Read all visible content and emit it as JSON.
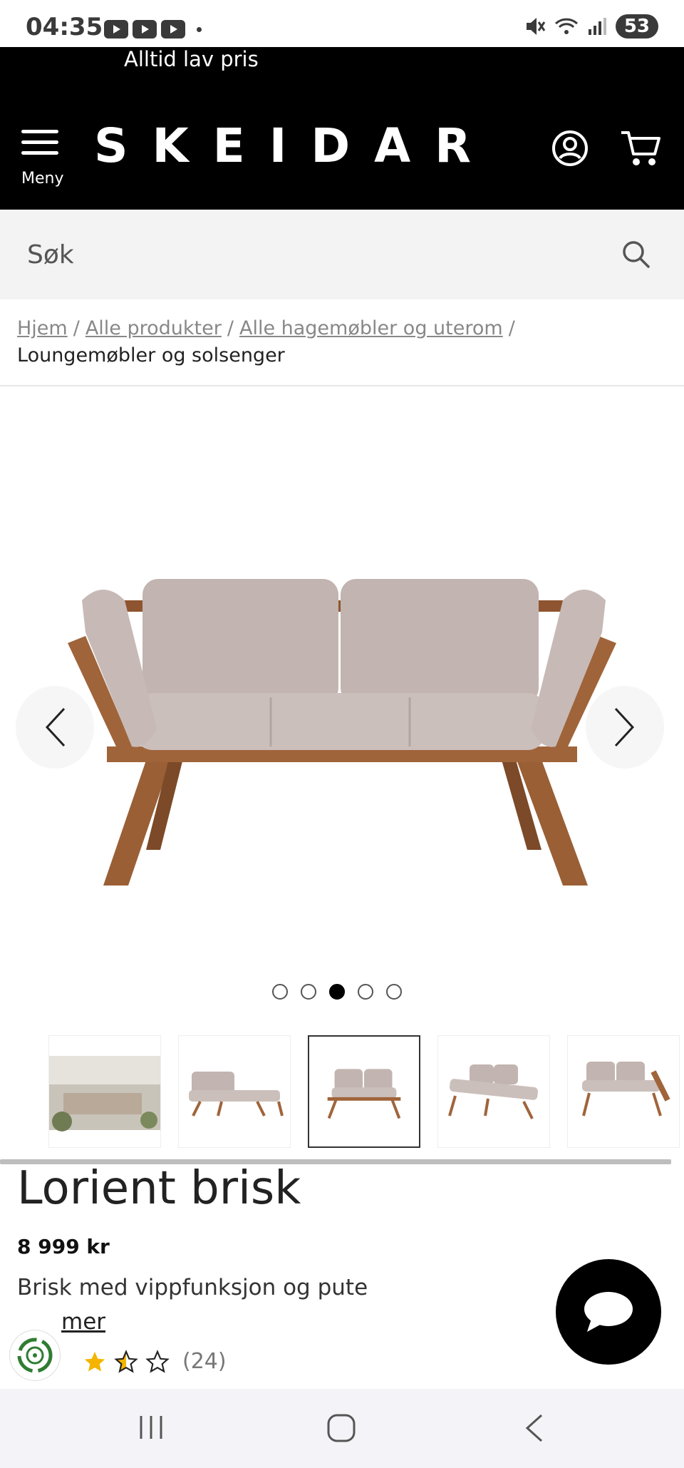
{
  "status_bar": {
    "time": "04:35",
    "battery": "53"
  },
  "header": {
    "promo": "Alltid lav pris",
    "menu_label": "Meny",
    "logo": "SKEIDAR"
  },
  "search": {
    "placeholder": "Søk"
  },
  "breadcrumb": {
    "links": [
      "Hjem",
      "Alle produkter",
      "Alle hagemøbler og uterom"
    ],
    "separator": "/",
    "current": "Loungemøbler og solsenger"
  },
  "gallery": {
    "slide_count": 5,
    "active_slide": 3,
    "thumbnail_count": 5,
    "active_thumbnail": 3
  },
  "product": {
    "title": "Lorient brisk",
    "price": "8 999 kr",
    "description": "Brisk med vippfunksjon og pute",
    "read_more": "mer",
    "rating": 2.5,
    "rating_count": "(24)"
  },
  "colors": {
    "header_bg": "#000000",
    "search_bg": "#f3f3f3",
    "star": "#f4b400",
    "cushion": "#c9bcb8",
    "wood": "#a0643a"
  },
  "icons": [
    "menu-icon",
    "account-icon",
    "cart-icon",
    "search-icon",
    "chevron-left-icon",
    "chevron-right-icon",
    "chat-icon",
    "star-icon",
    "eco-icon"
  ]
}
